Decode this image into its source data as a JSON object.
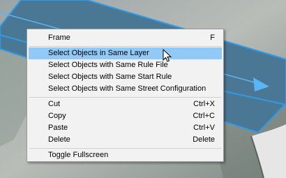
{
  "menu": {
    "items": [
      {
        "label": "Frame",
        "shortcut": "F"
      },
      {
        "label": "Select Objects in Same Layer",
        "shortcut": ""
      },
      {
        "label": "Select Objects with Same Rule File",
        "shortcut": ""
      },
      {
        "label": "Select Objects with Same Start Rule",
        "shortcut": ""
      },
      {
        "label": "Select Objects with Same Street Configuration",
        "shortcut": ""
      },
      {
        "label": "Cut",
        "shortcut": "Ctrl+X"
      },
      {
        "label": "Copy",
        "shortcut": "Ctrl+C"
      },
      {
        "label": "Paste",
        "shortcut": "Ctrl+V"
      },
      {
        "label": "Delete",
        "shortcut": "Delete"
      },
      {
        "label": "Toggle Fullscreen",
        "shortcut": ""
      }
    ],
    "highlighted_index": 1
  },
  "colors": {
    "selection_fill": "#4a7894",
    "selection_outline": "#2f9be8",
    "highlight": "#91c9f7"
  },
  "icons": {
    "cursor": "mouse-pointer-icon",
    "direction_arrow": "arrow-right-icon"
  }
}
